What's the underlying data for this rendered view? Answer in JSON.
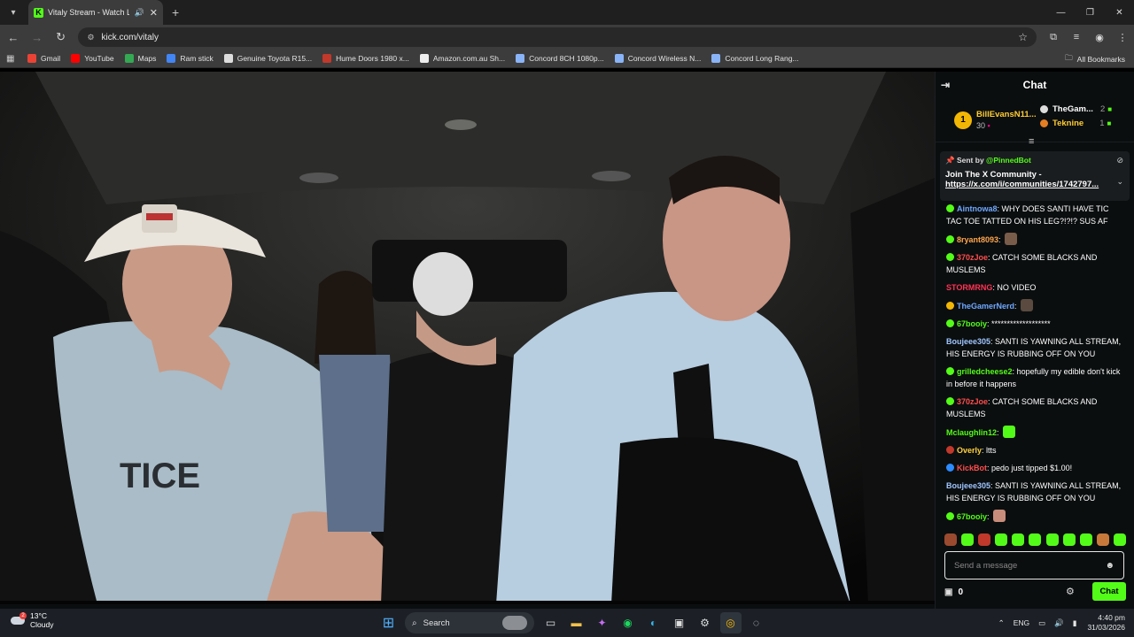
{
  "browser": {
    "tab_title": "Vitaly Stream - Watch Live ...",
    "url": "kick.com/vitaly",
    "bookmarks": [
      {
        "label": "Gmail",
        "color": "#ea4335"
      },
      {
        "label": "YouTube",
        "color": "#ff0000"
      },
      {
        "label": "Maps",
        "color": "#34a853"
      },
      {
        "label": "Ram stick",
        "color": "#4285f4"
      },
      {
        "label": "Genuine Toyota R15...",
        "color": "#dddddd"
      },
      {
        "label": "Hume Doors 1980 x...",
        "color": "#c0392b"
      },
      {
        "label": "Amazon.com.au Sh...",
        "color": "#eeeeee"
      },
      {
        "label": "Concord 8CH 1080p...",
        "color": "#8ab4f8"
      },
      {
        "label": "Concord Wireless N...",
        "color": "#8ab4f8"
      },
      {
        "label": "Concord Long Rang...",
        "color": "#8ab4f8"
      }
    ],
    "all_bookmarks": "All Bookmarks"
  },
  "chat": {
    "title": "Chat",
    "leaderboard": {
      "first": {
        "rank": "1",
        "name": "BillEvansN11...",
        "count": "30"
      },
      "others": [
        {
          "name": "TheGam...",
          "count": "2",
          "color": "#ffffff",
          "icon_color": "#dddddd"
        },
        {
          "name": "Teknine",
          "count": "1",
          "color": "#ffcc33",
          "icon_color": "#e67e22"
        }
      ]
    },
    "pinned": {
      "sent_by_label": "Sent by",
      "bot": "@PinnedBot",
      "text": "Join The X Community -",
      "link": "https://x.com/i/communities/1742797..."
    },
    "messages": [
      {
        "user": "Aintnowa8",
        "color": "#6fa8ff",
        "badge": "#53fc18",
        "text": "WHY DOES SANTI HAVE TIC TAC TOE TATTED ON HIS LEG?!?!? SUS AF"
      },
      {
        "user": "8ryant8093",
        "color": "#ffa64d",
        "badge": "#53fc18",
        "text": "",
        "emote": "#7a5c4a"
      },
      {
        "user": "370zJoe",
        "color": "#ff4d4d",
        "badge": "#53fc18",
        "text": "CATCH SOME BLACKS AND MUSLEMS"
      },
      {
        "user": "STORMRNG",
        "color": "#ff3355",
        "badge": "",
        "text": "NO VIDEO"
      },
      {
        "user": "TheGamerNerd",
        "color": "#6fa8ff",
        "badge": "#f2b705",
        "text": "",
        "emote": "#5a4a40"
      },
      {
        "user": "67booiy",
        "color": "#53fc18",
        "badge": "#53fc18",
        "text": "*******************"
      },
      {
        "user": "Boujeee305",
        "color": "#9fc6ff",
        "badge": "",
        "text": "SANTI IS YAWNING ALL STREAM, HIS ENERGY IS RUBBING OFF ON YOU"
      },
      {
        "user": "grilledcheese2",
        "color": "#53fc18",
        "badge": "#53fc18",
        "text": "hopefully my edible don't kick in before it happens"
      },
      {
        "user": "370zJoe",
        "color": "#ff4d4d",
        "badge": "#53fc18",
        "text": "CATCH SOME BLACKS AND MUSLEMS"
      },
      {
        "user": "Mclaughlin12",
        "color": "#53fc18",
        "badge": "",
        "text": "",
        "emote": "#53fc18"
      },
      {
        "user": "Overly",
        "color": "#ffd23f",
        "badge": "#c0392b",
        "text": "ltts"
      },
      {
        "user": "KickBot",
        "color": "#ff4d4d",
        "badge": "#2d8cff",
        "text": "pedo just tipped $1.00!"
      },
      {
        "user": "Boujeee305",
        "color": "#9fc6ff",
        "badge": "",
        "text": "SANTI IS YAWNING ALL STREAM, HIS ENERGY IS RUBBING OFF ON YOU"
      },
      {
        "user": "67booiy",
        "color": "#53fc18",
        "badge": "#53fc18",
        "text": "",
        "emote": "#c98d7b"
      }
    ],
    "emote_bar": [
      "#9b4a2f",
      "#53fc18",
      "#c0392b",
      "#53fc18",
      "#53fc18",
      "#53fc18",
      "#53fc18",
      "#53fc18",
      "#53fc18",
      "#c97a3a",
      "#53fc18"
    ],
    "input_placeholder": "Send a message",
    "points": "0",
    "send_label": "Chat"
  },
  "taskbar": {
    "temp": "13°C",
    "condition": "Cloudy",
    "search_label": "Search",
    "language": "ENG",
    "time": "4:40 pm",
    "date": "31/03/2026"
  }
}
